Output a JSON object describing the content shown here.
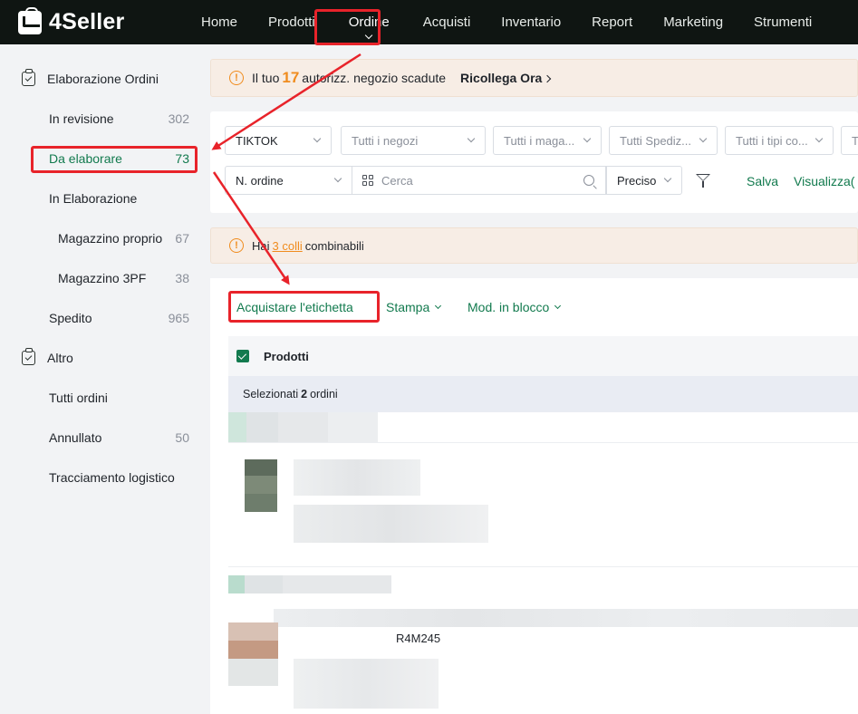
{
  "app": {
    "logo_text": "4Seller",
    "nav": [
      "Home",
      "Prodotti",
      "Ordine",
      "Acquisti",
      "Inventario",
      "Report",
      "Marketing",
      "Strumenti"
    ],
    "active_nav": "Ordine"
  },
  "sidebar": {
    "groups": [
      {
        "label": "Elaborazione Ordini",
        "items": [
          {
            "label": "In revisione",
            "count": "302"
          },
          {
            "label": "Da elaborare",
            "count": "73",
            "active": true
          },
          {
            "label": "In Elaborazione",
            "count": ""
          },
          {
            "label": "Magazzino proprio",
            "count": "67",
            "sub": true
          },
          {
            "label": "Magazzino 3PF",
            "count": "38",
            "sub": true
          },
          {
            "label": "Spedito",
            "count": "965"
          }
        ]
      },
      {
        "label": "Altro",
        "items": [
          {
            "label": "Tutti ordini",
            "count": ""
          },
          {
            "label": "Annullato",
            "count": "50"
          },
          {
            "label": "Tracciamento logistico",
            "count": ""
          }
        ]
      }
    ]
  },
  "banner_top": {
    "pre": "Il tuo",
    "number": "17",
    "post": "autorizz. negozio scadute",
    "action": "Ricollega Ora"
  },
  "filters": {
    "platform": "TIKTOK",
    "shops_placeholder": "Tutti i negozi",
    "warehouses_placeholder": "Tutti i maga...",
    "shipping_placeholder": "Tutti Spediz...",
    "types_placeholder": "Tutti i tipi co...",
    "extra_placeholder": "T",
    "search_field": "N. ordine",
    "search_placeholder": "Cerca",
    "match_mode": "Preciso",
    "save_label": "Salva",
    "view_label": "Visualizza("
  },
  "banner_combine": {
    "pre": "Hai",
    "link": "3 colli",
    "post": "combinabili"
  },
  "orders": {
    "actions": {
      "buy_label": "Acquistare l'etichetta",
      "print_label": "Stampa",
      "bulk_label": "Mod. in blocco"
    },
    "header_products": "Prodotti",
    "selected_pre": "Selezionati",
    "selected_count": "2",
    "selected_post": "ordini",
    "visible_code_fragment": "R4M245"
  },
  "colors": {
    "accent_green": "#127a4e",
    "warning_orange": "#f08c1e",
    "highlight_red": "#e8232a",
    "nav_bg": "#0f1512"
  }
}
